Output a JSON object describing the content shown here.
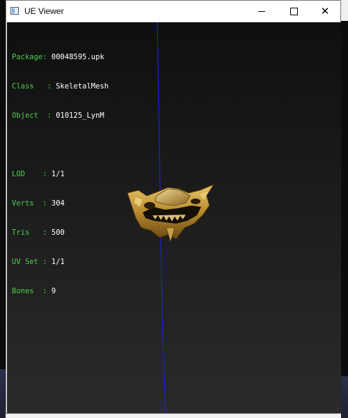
{
  "window": {
    "title": "UE Viewer"
  },
  "info": {
    "package": {
      "label": "Package: ",
      "value": "00048595.upk"
    },
    "class": {
      "label": "Class   : ",
      "value": "SkeletalMesh"
    },
    "object": {
      "label": "Object  : ",
      "value": "010125_LynM"
    },
    "lod": {
      "label": "LOD    : ",
      "value": "1/1"
    },
    "verts": {
      "label": "Verts  : ",
      "value": "304"
    },
    "tris": {
      "label": "Tris   : ",
      "value": "500"
    },
    "uvset": {
      "label": "UV Set : ",
      "value": "1/1"
    },
    "bones": {
      "label": "Bones  : ",
      "value": "9"
    }
  },
  "colors": {
    "label_green": "#4ccf4c",
    "value_white": "#ffffff",
    "axis_blue": "#1f1fd0",
    "viewport_bg": "#1a1a1a"
  },
  "icons": [
    "app-window-icon",
    "minimize-icon",
    "maximize-icon",
    "close-icon"
  ]
}
